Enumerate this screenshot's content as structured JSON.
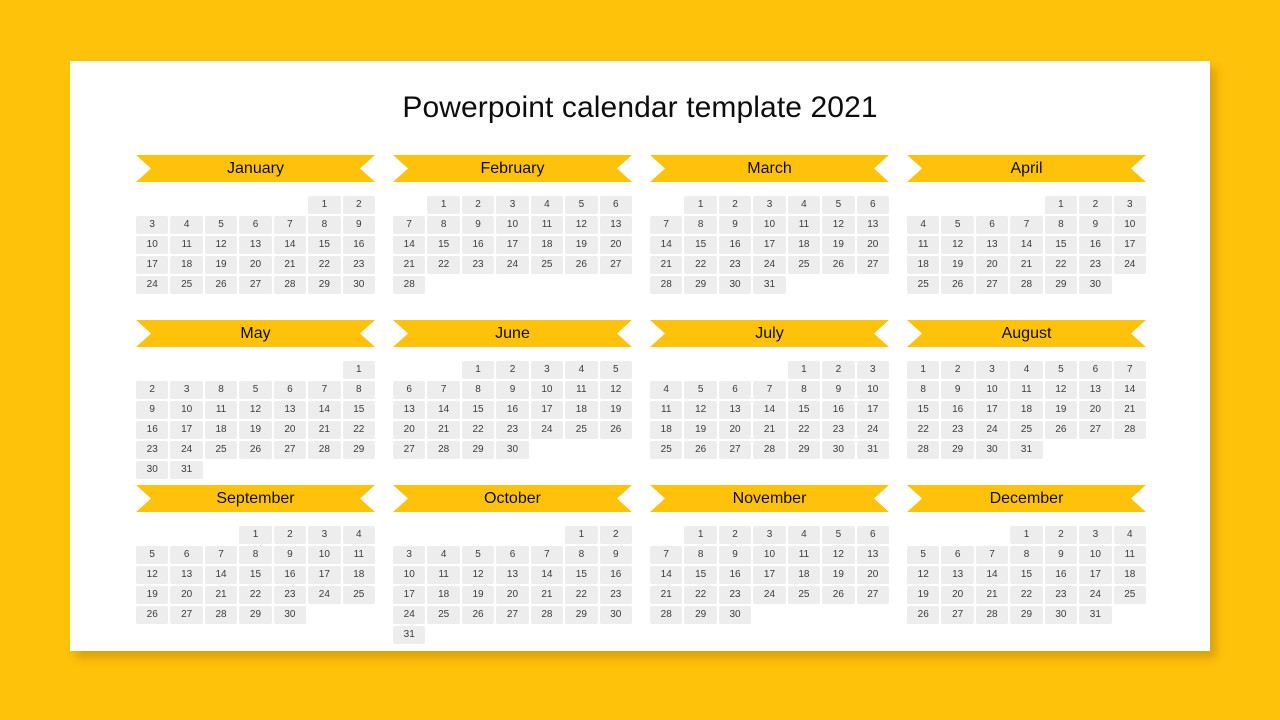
{
  "background_color": "#FFC20A",
  "slide_color": "#FFFFFF",
  "accent_color": "#FFC20A",
  "day_cell_color": "#EDEDED",
  "title": "Powerpoint calendar template 2021",
  "calendar": {
    "year": "2021",
    "months": [
      {
        "name": "January",
        "weeks": [
          [
            "",
            "",
            "",
            "",
            "",
            "1",
            "2"
          ],
          [
            "3",
            "4",
            "5",
            "6",
            "7",
            "8",
            "9"
          ],
          [
            "10",
            "11",
            "12",
            "13",
            "14",
            "15",
            "16"
          ],
          [
            "17",
            "18",
            "19",
            "20",
            "21",
            "22",
            "23"
          ],
          [
            "24",
            "25",
            "26",
            "27",
            "28",
            "29",
            "30"
          ]
        ]
      },
      {
        "name": "February",
        "weeks": [
          [
            "",
            "1",
            "2",
            "3",
            "4",
            "5",
            "6"
          ],
          [
            "7",
            "8",
            "9",
            "10",
            "11",
            "12",
            "13"
          ],
          [
            "14",
            "15",
            "16",
            "17",
            "18",
            "19",
            "20"
          ],
          [
            "21",
            "22",
            "23",
            "24",
            "25",
            "26",
            "27"
          ],
          [
            "28",
            "",
            "",
            "",
            "",
            "",
            ""
          ]
        ]
      },
      {
        "name": "March",
        "weeks": [
          [
            "",
            "1",
            "2",
            "3",
            "4",
            "5",
            "6"
          ],
          [
            "7",
            "8",
            "9",
            "10",
            "11",
            "12",
            "13"
          ],
          [
            "14",
            "15",
            "16",
            "17",
            "18",
            "19",
            "20"
          ],
          [
            "21",
            "22",
            "23",
            "24",
            "25",
            "26",
            "27"
          ],
          [
            "28",
            "29",
            "30",
            "31",
            "",
            "",
            ""
          ]
        ]
      },
      {
        "name": "April",
        "weeks": [
          [
            "",
            "",
            "",
            "",
            "1",
            "2",
            "3"
          ],
          [
            "4",
            "5",
            "6",
            "7",
            "8",
            "9",
            "10"
          ],
          [
            "11",
            "12",
            "13",
            "14",
            "15",
            "16",
            "17"
          ],
          [
            "18",
            "19",
            "20",
            "21",
            "22",
            "23",
            "24"
          ],
          [
            "25",
            "26",
            "27",
            "28",
            "29",
            "30",
            ""
          ]
        ]
      },
      {
        "name": "May",
        "weeks": [
          [
            "",
            "",
            "",
            "",
            "",
            "",
            "1"
          ],
          [
            "2",
            "3",
            "8",
            "5",
            "6",
            "7",
            "8"
          ],
          [
            "9",
            "10",
            "11",
            "12",
            "13",
            "14",
            "15"
          ],
          [
            "16",
            "17",
            "18",
            "19",
            "20",
            "21",
            "22"
          ],
          [
            "23",
            "24",
            "25",
            "26",
            "27",
            "28",
            "29"
          ],
          [
            "30",
            "31",
            "",
            "",
            "",
            "",
            ""
          ]
        ]
      },
      {
        "name": "June",
        "weeks": [
          [
            "",
            "",
            "1",
            "2",
            "3",
            "4",
            "5"
          ],
          [
            "6",
            "7",
            "8",
            "9",
            "10",
            "11",
            "12"
          ],
          [
            "13",
            "14",
            "15",
            "16",
            "17",
            "18",
            "19"
          ],
          [
            "20",
            "21",
            "22",
            "23",
            "24",
            "25",
            "26"
          ],
          [
            "27",
            "28",
            "29",
            "30",
            "",
            "",
            ""
          ]
        ]
      },
      {
        "name": "July",
        "weeks": [
          [
            "",
            "",
            "",
            "",
            "1",
            "2",
            "3"
          ],
          [
            "4",
            "5",
            "6",
            "7",
            "8",
            "9",
            "10"
          ],
          [
            "11",
            "12",
            "13",
            "14",
            "15",
            "16",
            "17"
          ],
          [
            "18",
            "19",
            "20",
            "21",
            "22",
            "23",
            "24"
          ],
          [
            "25",
            "26",
            "27",
            "28",
            "29",
            "30",
            "31"
          ]
        ]
      },
      {
        "name": "August",
        "weeks": [
          [
            "1",
            "2",
            "3",
            "4",
            "5",
            "6",
            "7"
          ],
          [
            "8",
            "9",
            "10",
            "11",
            "12",
            "13",
            "14"
          ],
          [
            "15",
            "16",
            "17",
            "18",
            "19",
            "20",
            "21"
          ],
          [
            "22",
            "23",
            "24",
            "25",
            "26",
            "27",
            "28"
          ],
          [
            "28",
            "29",
            "30",
            "31",
            "",
            "",
            ""
          ]
        ]
      },
      {
        "name": "September",
        "weeks": [
          [
            "",
            "",
            "",
            "1",
            "2",
            "3",
            "4"
          ],
          [
            "5",
            "6",
            "7",
            "8",
            "9",
            "10",
            "11"
          ],
          [
            "12",
            "13",
            "14",
            "15",
            "16",
            "17",
            "18"
          ],
          [
            "19",
            "20",
            "21",
            "22",
            "23",
            "24",
            "25"
          ],
          [
            "26",
            "27",
            "28",
            "29",
            "30",
            "",
            ""
          ]
        ]
      },
      {
        "name": "October",
        "weeks": [
          [
            "",
            "",
            "",
            "",
            "",
            "1",
            "2"
          ],
          [
            "3",
            "4",
            "5",
            "6",
            "7",
            "8",
            "9"
          ],
          [
            "10",
            "11",
            "12",
            "13",
            "14",
            "15",
            "16"
          ],
          [
            "17",
            "18",
            "19",
            "20",
            "21",
            "22",
            "23"
          ],
          [
            "24",
            "25",
            "26",
            "27",
            "28",
            "29",
            "30"
          ],
          [
            "31",
            "",
            "",
            "",
            "",
            "",
            ""
          ]
        ]
      },
      {
        "name": "November",
        "weeks": [
          [
            "",
            "1",
            "2",
            "3",
            "4",
            "5",
            "6"
          ],
          [
            "7",
            "8",
            "9",
            "10",
            "11",
            "12",
            "13"
          ],
          [
            "14",
            "15",
            "16",
            "17",
            "18",
            "19",
            "20"
          ],
          [
            "21",
            "22",
            "23",
            "24",
            "25",
            "26",
            "27"
          ],
          [
            "28",
            "29",
            "30",
            "",
            "",
            "",
            ""
          ]
        ]
      },
      {
        "name": "December",
        "weeks": [
          [
            "",
            "",
            "",
            "1",
            "2",
            "3",
            "4"
          ],
          [
            "5",
            "6",
            "7",
            "8",
            "9",
            "10",
            "11"
          ],
          [
            "12",
            "13",
            "14",
            "15",
            "16",
            "17",
            "18"
          ],
          [
            "19",
            "20",
            "21",
            "22",
            "23",
            "24",
            "25"
          ],
          [
            "26",
            "27",
            "28",
            "29",
            "30",
            "31",
            ""
          ]
        ]
      }
    ]
  }
}
